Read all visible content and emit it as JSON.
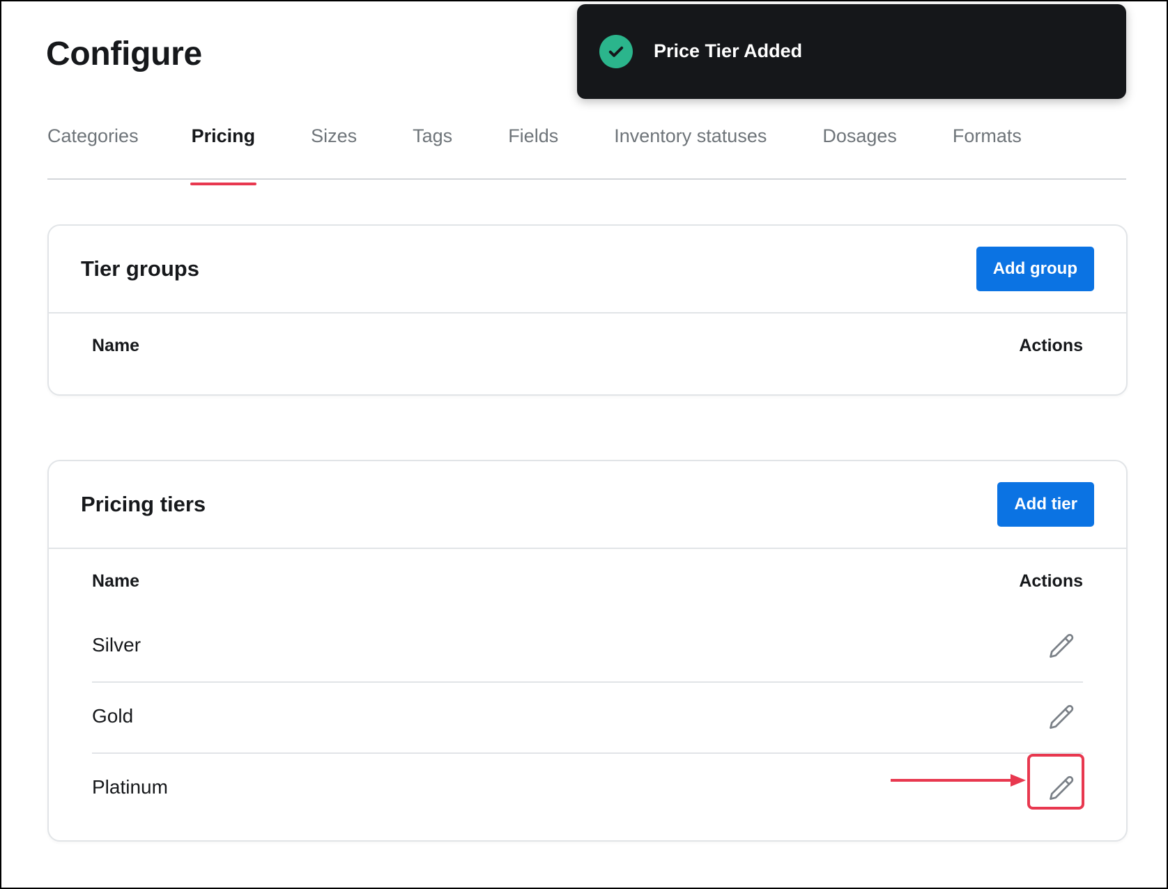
{
  "page": {
    "title": "Configure"
  },
  "tabs": [
    {
      "label": "Categories",
      "active": false
    },
    {
      "label": "Pricing",
      "active": true
    },
    {
      "label": "Sizes",
      "active": false
    },
    {
      "label": "Tags",
      "active": false
    },
    {
      "label": "Fields",
      "active": false
    },
    {
      "label": "Inventory statuses",
      "active": false
    },
    {
      "label": "Dosages",
      "active": false
    },
    {
      "label": "Formats",
      "active": false
    }
  ],
  "toast": {
    "message": "Price Tier Added",
    "icon": "check-circle-icon",
    "icon_color": "#2bb58c"
  },
  "tier_groups": {
    "title": "Tier groups",
    "add_button_label": "Add group",
    "columns": {
      "name": "Name",
      "actions": "Actions"
    },
    "rows": []
  },
  "pricing_tiers": {
    "title": "Pricing tiers",
    "add_button_label": "Add tier",
    "columns": {
      "name": "Name",
      "actions": "Actions"
    },
    "rows": [
      {
        "name": "Silver",
        "action_icon": "pencil-icon"
      },
      {
        "name": "Gold",
        "action_icon": "pencil-icon"
      },
      {
        "name": "Platinum",
        "action_icon": "pencil-icon",
        "highlighted": true
      }
    ]
  },
  "colors": {
    "primary_button": "#0b73e3",
    "active_tab_underline": "#e8384f",
    "annotation": "#e8384f",
    "toast_background": "#15171a"
  }
}
